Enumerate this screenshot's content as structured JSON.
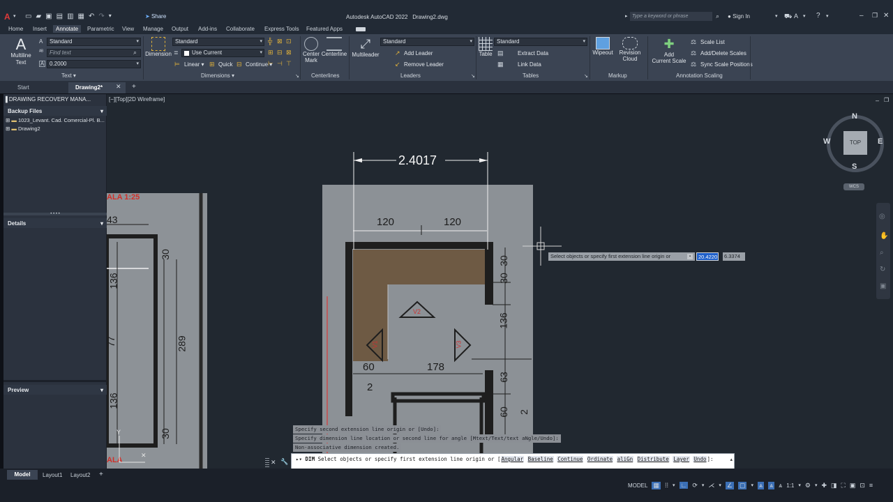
{
  "app": {
    "title": "Autodesk AutoCAD 2022",
    "document": "Drawing2.dwg",
    "share_label": "Share",
    "search_placeholder": "Type a keyword or phrase",
    "sign_in_label": "Sign In"
  },
  "menu": [
    "Home",
    "Insert",
    "Annotate",
    "Parametric",
    "View",
    "Manage",
    "Output",
    "Add-ins",
    "Collaborate",
    "Express Tools",
    "Featured Apps"
  ],
  "active_menu": "Annotate",
  "ribbon": {
    "text_panel": {
      "label": "Text",
      "big_button": [
        "Multiline",
        "Text"
      ],
      "style_value": "Standard",
      "find_placeholder": "Find text",
      "height_value": "0.2000"
    },
    "dimensions_panel": {
      "label": "Dimensions",
      "big_button": "Dimension",
      "style_value": "Standard",
      "layer_value": "Use Current",
      "linear_label": "Linear",
      "quick_label": "Quick",
      "continue_label": "Continue"
    },
    "centerlines_panel": {
      "label": "Centerlines",
      "center_mark": [
        "Center",
        "Mark"
      ],
      "centerline": "Centerline"
    },
    "leaders_panel": {
      "label": "Leaders",
      "big_button": "Multileader",
      "style_value": "Standard",
      "add_leader": "Add Leader",
      "remove_leader": "Remove Leader"
    },
    "tables_panel": {
      "label": "Tables",
      "big_button": "Table",
      "style_value": "Standard",
      "extract_data": "Extract Data",
      "link_data": "Link Data"
    },
    "markup_panel": {
      "label": "Markup",
      "wipeout": "Wipeout",
      "revision_cloud": [
        "Revision",
        "Cloud"
      ]
    },
    "annotation_scaling_panel": {
      "label": "Annotation Scaling",
      "add_current_scale": [
        "Add",
        "Current Scale"
      ],
      "scale_list": "Scale List",
      "add_delete_scales": "Add/Delete Scales",
      "sync_scale_positions": "Sync Scale Positions"
    }
  },
  "doc_tabs": [
    "Start",
    "Drawing2*"
  ],
  "left_panel": {
    "title": "DRAWING RECOVERY MANA...",
    "backup_header": "Backup Files",
    "files": [
      "1023_Levant. Cad. Comercial-Pl. B...",
      "Drawing2"
    ],
    "details_header": "Details",
    "preview_header": "Preview"
  },
  "viewport": {
    "label": "[−][Top][2D Wireframe]",
    "viewcube": {
      "top": "TOP",
      "n": "N",
      "s": "S",
      "e": "E",
      "w": "W",
      "wcs": "WCS"
    }
  },
  "drawing": {
    "main_dimension": "2.4017",
    "dims": [
      "120",
      "120",
      "30",
      "30",
      "136",
      "63",
      "60",
      "60",
      "178",
      "2",
      "2",
      "289",
      "43",
      "30",
      "136",
      "77",
      "136",
      "30"
    ],
    "scale_note": "ALA 1:25",
    "ala": "ALA",
    "labels": [
      "V2",
      "V1",
      "V3"
    ]
  },
  "tooltip": {
    "prompt": "Select objects or specify first extension line origin or",
    "x_value": "20.4220",
    "y_value": "6.3374"
  },
  "command_history": [
    "Specify second extension line origin or [Undo]:",
    "Specify dimension line location or second line for angle [Mtext/Text/text aNgle/Undo]:",
    "Non-associative dimension created."
  ],
  "command_line": {
    "command": "DIM",
    "prompt": "Select objects or specify first extension line origin or [",
    "options": [
      "Angular",
      "Baseline",
      "Continue",
      "Ordinate",
      "aliGn",
      "Distribute",
      "Layer",
      "Undo"
    ],
    "suffix": "]:"
  },
  "layout_tabs": [
    "Model",
    "Layout1",
    "Layout2"
  ],
  "status": {
    "model": "MODEL",
    "scale": "1:1"
  }
}
